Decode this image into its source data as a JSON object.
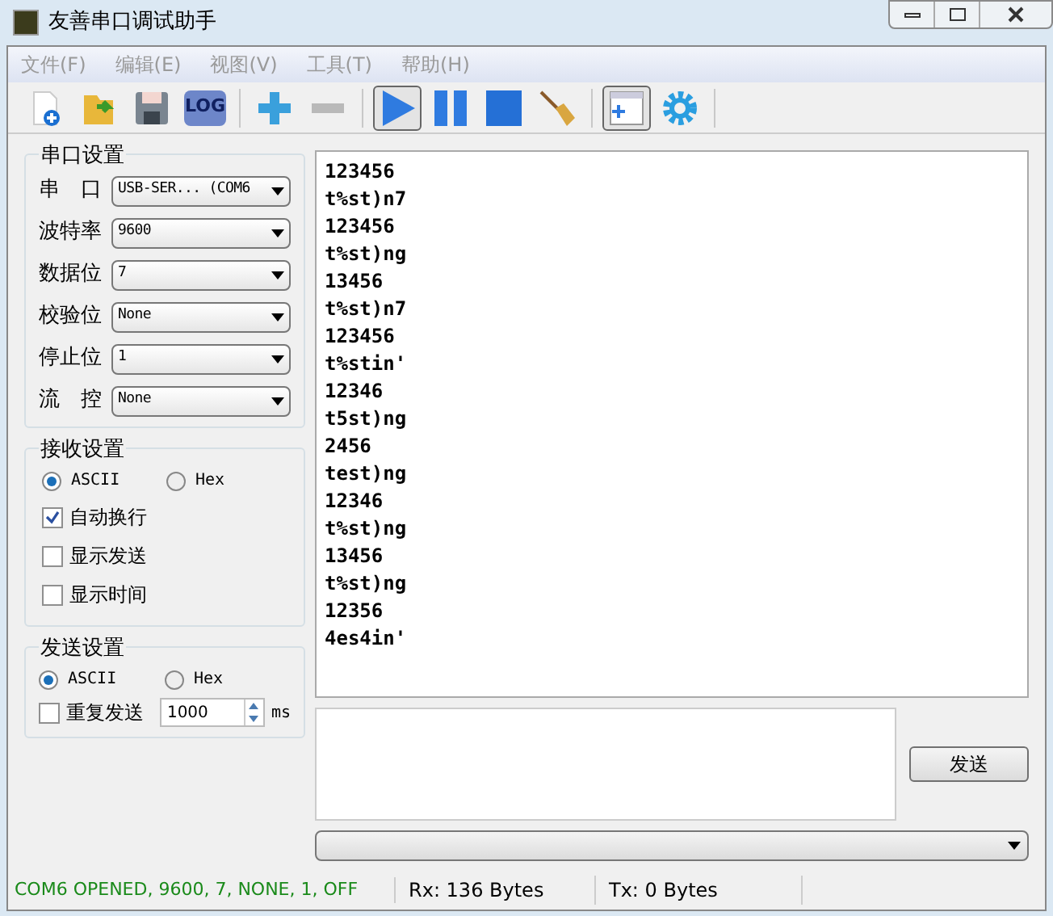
{
  "window": {
    "title": "友善串口调试助手"
  },
  "menu": [
    {
      "label": "文件(F)",
      "disabled": true
    },
    {
      "label": "编辑(E)",
      "disabled": true
    },
    {
      "label": "视图(V)",
      "disabled": true
    },
    {
      "label": "工具(T)",
      "disabled": true
    },
    {
      "label": "帮助(H)",
      "disabled": true
    }
  ],
  "toolbar": [
    {
      "kind": "new",
      "pressed": false
    },
    {
      "kind": "open",
      "pressed": false
    },
    {
      "kind": "save",
      "pressed": false
    },
    {
      "kind": "log",
      "label": "LOG",
      "pressed": false
    },
    {
      "kind": "sep"
    },
    {
      "kind": "plus",
      "pressed": false
    },
    {
      "kind": "minus",
      "pressed": false
    },
    {
      "kind": "sep"
    },
    {
      "kind": "play",
      "pressed": true
    },
    {
      "kind": "pause",
      "pressed": false
    },
    {
      "kind": "stop",
      "pressed": false
    },
    {
      "kind": "broom",
      "pressed": false
    },
    {
      "kind": "sep"
    },
    {
      "kind": "window",
      "pressed": true
    },
    {
      "kind": "gear",
      "pressed": false
    },
    {
      "kind": "sep"
    }
  ],
  "serial_settings": {
    "title": "串口设置",
    "fields": [
      {
        "label": "串　口",
        "value": "USB-SER... (COM6"
      },
      {
        "label": "波特率",
        "value": "9600"
      },
      {
        "label": "数据位",
        "value": "7"
      },
      {
        "label": "校验位",
        "value": "None"
      },
      {
        "label": "停止位",
        "value": "1"
      },
      {
        "label": "流　控",
        "value": "None"
      }
    ]
  },
  "receive_settings": {
    "title": "接收设置",
    "modes": [
      {
        "label": "ASCII",
        "selected": true
      },
      {
        "label": "Hex",
        "selected": false
      }
    ],
    "options": [
      {
        "label": "自动换行",
        "checked": true
      },
      {
        "label": "显示发送",
        "checked": false
      },
      {
        "label": "显示时间",
        "checked": false
      }
    ]
  },
  "send_settings": {
    "title": "发送设置",
    "modes": [
      {
        "label": "ASCII",
        "selected": true
      },
      {
        "label": "Hex",
        "selected": false
      }
    ],
    "repeat": {
      "label": "重复发送",
      "checked": false
    },
    "interval": "1000",
    "unit": "ms"
  },
  "receive_lines": [
    "123456",
    "t%st)n7",
    "123456",
    "t%st)ng",
    "13456",
    "t%st)n7",
    "123456",
    "t%stin'",
    "12346",
    "t5st)ng",
    "2456",
    "test)ng",
    "12346",
    "t%st)ng",
    "13456",
    "t%st)ng",
    "12356",
    "4es4in'"
  ],
  "send_button": "发送",
  "status_bar": {
    "connection": "COM6 OPENED, 9600, 7, NONE, 1, OFF",
    "rx": "Rx: 136 Bytes",
    "tx": "Tx: 0 Bytes"
  }
}
